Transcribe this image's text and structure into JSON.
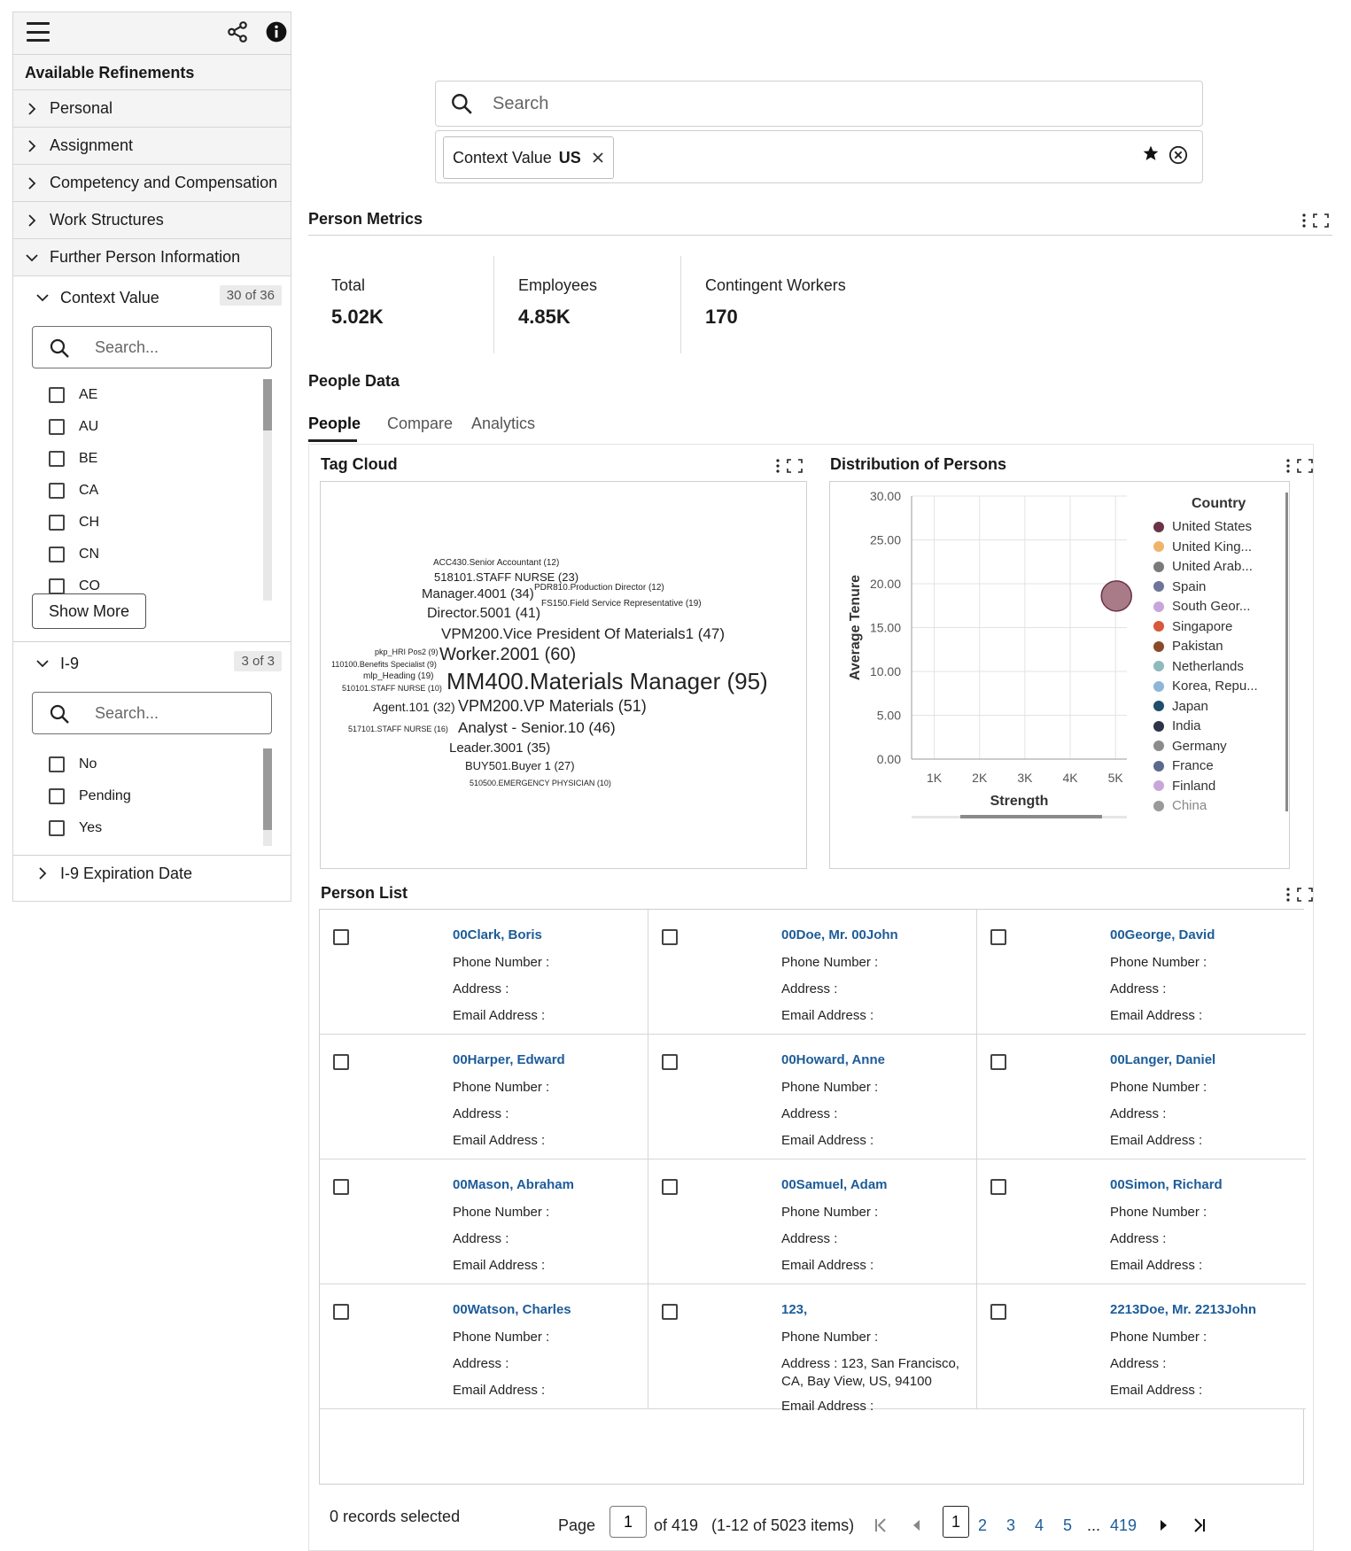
{
  "sidebar": {
    "heading": "Available Refinements",
    "sections": [
      {
        "label": "Personal"
      },
      {
        "label": "Assignment"
      },
      {
        "label": "Competency and Compensation"
      },
      {
        "label": "Work Structures"
      },
      {
        "label": "Further Person Information"
      }
    ],
    "context_value": {
      "label": "Context Value",
      "count": "30 of 36",
      "search_placeholder": "Search...",
      "options": [
        "AE",
        "AU",
        "BE",
        "CA",
        "CH",
        "CN",
        "CO"
      ],
      "show_more": "Show More"
    },
    "i9": {
      "label": "I-9",
      "count": "3 of 3",
      "search_placeholder": "Search...",
      "options": [
        "No",
        "Pending",
        "Yes"
      ]
    },
    "i9_expiration": {
      "label": "I-9 Expiration Date"
    }
  },
  "search": {
    "placeholder": "Search",
    "chip_label": "Context Value",
    "chip_value": "US"
  },
  "metrics": {
    "title": "Person Metrics",
    "items": [
      {
        "label": "Total",
        "value": "5.02K"
      },
      {
        "label": "Employees",
        "value": "4.85K"
      },
      {
        "label": "Contingent Workers",
        "value": "170"
      }
    ]
  },
  "people_data": {
    "title": "People Data",
    "tabs": [
      "People",
      "Compare",
      "Analytics"
    ],
    "active_tab": "People"
  },
  "tag_cloud": {
    "title": "Tag Cloud",
    "tags": [
      "ACC430.Senior Accountant (12)",
      "518101.STAFF NURSE (23)",
      "PDR810.Production Director (12)",
      "Manager.4001 (34)",
      "FS150.Field Service Representative (19)",
      "Director.5001 (41)",
      "VPM200.Vice President Of Materials1 (47)",
      "pkp_HRI Pos2 (9)",
      "Worker.2001 (60)",
      "110100.Benefits Specialist (9)",
      "mlp_Heading (19)",
      "MM400.Materials Manager (95)",
      "510101.STAFF NURSE (10)",
      "Agent.101 (32)",
      "VPM200.VP Materials (51)",
      "517101.STAFF NURSE (16)",
      "Analyst - Senior.10 (46)",
      "Leader.3001 (35)",
      "BUY501.Buyer 1 (27)",
      "510500.EMERGENCY PHYSICIAN (10)"
    ]
  },
  "distribution": {
    "title": "Distribution of Persons",
    "legend_title": "Country",
    "legend": [
      {
        "label": "United States",
        "color": "#6b3347"
      },
      {
        "label": "United King...",
        "color": "#f0b36b"
      },
      {
        "label": "United Arab...",
        "color": "#7a7a7a"
      },
      {
        "label": "Spain",
        "color": "#6e7598"
      },
      {
        "label": "South Geor...",
        "color": "#c9a6d9"
      },
      {
        "label": "Singapore",
        "color": "#d9573b"
      },
      {
        "label": "Pakistan",
        "color": "#8a4a2a"
      },
      {
        "label": "Netherlands",
        "color": "#8fb9bd"
      },
      {
        "label": "Korea, Repu...",
        "color": "#8fb5d9"
      },
      {
        "label": "Japan",
        "color": "#1f4e6b"
      },
      {
        "label": "India",
        "color": "#2d3447"
      },
      {
        "label": "Germany",
        "color": "#8c8c8c"
      },
      {
        "label": "France",
        "color": "#5b6a8c"
      },
      {
        "label": "Finland",
        "color": "#c9a6d9"
      },
      {
        "label": "China",
        "color": "#9a9a9a"
      }
    ]
  },
  "chart_data": {
    "type": "scatter",
    "xlabel": "Strength",
    "ylabel": "Average Tenure",
    "x_ticks": [
      "1K",
      "2K",
      "3K",
      "4K",
      "5K"
    ],
    "y_ticks": [
      "0.00",
      "5.00",
      "10.00",
      "15.00",
      "20.00",
      "25.00",
      "30.00"
    ],
    "xlim": [
      500,
      5250
    ],
    "ylim": [
      0,
      30
    ],
    "grid": true,
    "legend_position": "right",
    "series": [
      {
        "name": "United States",
        "points": [
          {
            "x": 5020,
            "y": 18.6
          }
        ]
      }
    ]
  },
  "person_list": {
    "title": "Person List",
    "phone_label": "Phone Number :",
    "address_label": "Address :",
    "email_label": "Email Address :",
    "people": [
      {
        "name": "00Clark, Boris",
        "address": ""
      },
      {
        "name": "00Doe, Mr. 00John",
        "address": ""
      },
      {
        "name": "00George, David",
        "address": ""
      },
      {
        "name": "00Harper, Edward",
        "address": ""
      },
      {
        "name": "00Howard, Anne",
        "address": ""
      },
      {
        "name": "00Langer, Daniel",
        "address": ""
      },
      {
        "name": "00Mason, Abraham",
        "address": ""
      },
      {
        "name": "00Samuel, Adam",
        "address": ""
      },
      {
        "name": "00Simon, Richard",
        "address": ""
      },
      {
        "name": "00Watson, Charles",
        "address": ""
      },
      {
        "name": "123,",
        "address": "123, San Francisco,",
        "address2": "CA, Bay View, US, 94100"
      },
      {
        "name": "2213Doe, Mr. 2213John",
        "address": ""
      }
    ]
  },
  "pager": {
    "selected": "0 records selected",
    "page_label": "Page",
    "page_value": "1",
    "of_label": "of 419",
    "range": "(1-12 of 5023 items)",
    "pages": [
      "1",
      "2",
      "3",
      "4",
      "5"
    ],
    "ellipsis": "...",
    "last_page": "419"
  }
}
